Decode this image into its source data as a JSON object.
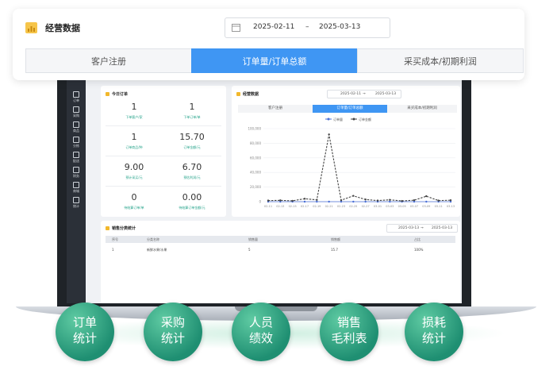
{
  "card": {
    "title": "经营数据",
    "date_start": "2025-02-11",
    "date_sep": "–",
    "date_end": "2025-03-13",
    "tabs": [
      {
        "label": "客户注册",
        "active": false
      },
      {
        "label": "订单量/订单总额",
        "active": true
      },
      {
        "label": "采买成本/初期利润",
        "active": false
      }
    ]
  },
  "screen": {
    "sidebar": [
      {
        "label": "管理",
        "icon": "grid-icon"
      },
      {
        "label": "订单",
        "icon": "document-icon"
      },
      {
        "label": "采购",
        "icon": "cart-icon"
      },
      {
        "label": "商品",
        "icon": "home-icon"
      },
      {
        "label": "分拣",
        "icon": "box-icon"
      },
      {
        "label": "配送",
        "icon": "truck-icon"
      },
      {
        "label": "财务",
        "icon": "database-icon"
      },
      {
        "label": "商城",
        "icon": "apps-icon"
      },
      {
        "label": "统计",
        "icon": "chart-icon"
      }
    ],
    "today": {
      "title": "今日订单",
      "stats": [
        {
          "value": "1",
          "label": "下单客户/家"
        },
        {
          "value": "1",
          "label": "下单订单/单"
        },
        {
          "value": "1",
          "label": "订单商品/种"
        },
        {
          "value": "15.70",
          "label": "订单金额/元"
        },
        {
          "value": "9.00",
          "label": "预计采买/元"
        },
        {
          "value": "6.70",
          "label": "预估利润/元"
        },
        {
          "value": "0",
          "label": "待结算订单/单"
        },
        {
          "value": "0.00",
          "label": "待结算订单金额/元"
        }
      ]
    },
    "biz": {
      "title": "经营数据",
      "date_start": "2025-02-11",
      "date_sep": "→",
      "date_end": "2025-03-13",
      "tabs": [
        "客户注册",
        "订单量/订单总额",
        "采买成本/初期利润"
      ]
    },
    "sales": {
      "title": "销售分类统计",
      "date_start": "2025-03-13",
      "date_sep": "→",
      "date_end": "2025-03-13",
      "headers": [
        "序号",
        "分类名称",
        "销售量",
        "销售额",
        "占比"
      ],
      "rows": [
        [
          "1",
          "新鲜水果/水果",
          "5",
          "15.7",
          "100%"
        ]
      ]
    }
  },
  "chart_data": {
    "type": "line",
    "legend": [
      "订单量",
      "订单金额"
    ],
    "y_ticks": [
      "100,000",
      "80,000",
      "60,000",
      "40,000",
      "20,000",
      "0"
    ],
    "ylim": [
      0,
      100000
    ],
    "x": [
      "02-11",
      "02-13",
      "02-15",
      "02-17",
      "02-19",
      "02-21",
      "02-23",
      "02-25",
      "02-27",
      "03-01",
      "03-03",
      "03-05",
      "03-07",
      "03-09",
      "03-11",
      "03-13"
    ],
    "series": [
      {
        "name": "订单量",
        "values": [
          1,
          1,
          1,
          1,
          1,
          1,
          1,
          1,
          1,
          1,
          1,
          1,
          1,
          1,
          1,
          1
        ]
      },
      {
        "name": "订单金额",
        "values": [
          1500,
          1800,
          1200,
          4000,
          2500,
          92000,
          2000,
          8000,
          3000,
          1500,
          2500,
          1000,
          2000,
          7500,
          1500,
          2000
        ]
      }
    ]
  },
  "features": [
    {
      "line1": "订单",
      "line2": "统计"
    },
    {
      "line1": "采购",
      "line2": "统计"
    },
    {
      "line1": "人员",
      "line2": "绩效"
    },
    {
      "line1": "销售",
      "line2": "毛利表"
    },
    {
      "line1": "损耗",
      "line2": "统计"
    }
  ],
  "colors": {
    "accent": "#3f96f3",
    "feature_green": "#1f8f72",
    "icon_yellow": "#f6c54a"
  }
}
